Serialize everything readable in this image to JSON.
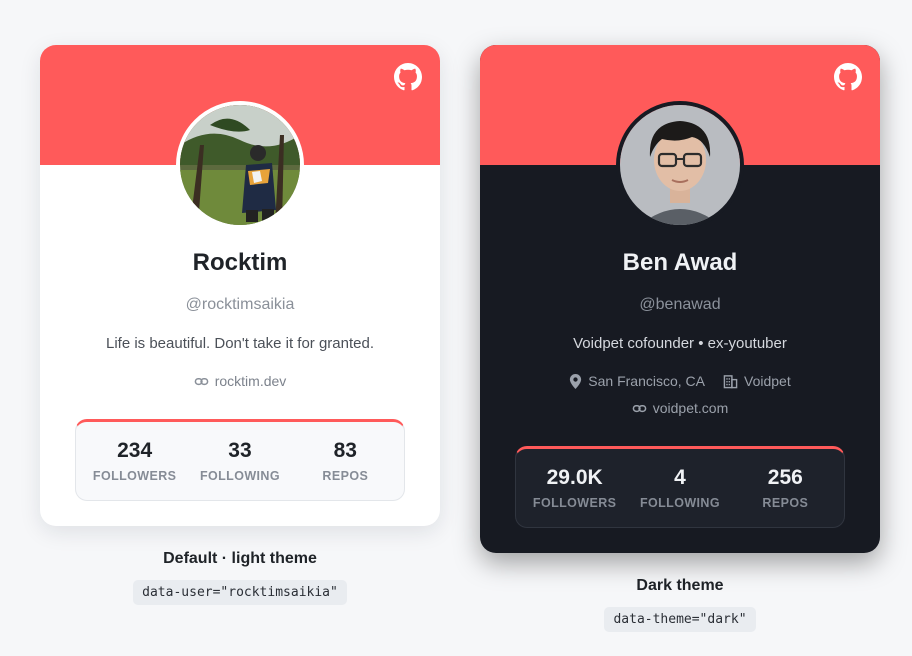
{
  "theme_colors": {
    "accent": "#ff5a5a",
    "light_card_bg": "#ffffff",
    "dark_card_bg": "#171a22"
  },
  "cards": [
    {
      "theme": "light",
      "icon": "github-icon",
      "name": "Rocktim",
      "handle": "@rocktimsaikia",
      "bio": "Life is beautiful. Don't take it for granted.",
      "website": "rocktim.dev",
      "stats": [
        {
          "value": "234",
          "label": "FOLLOWERS"
        },
        {
          "value": "33",
          "label": "FOLLOWING"
        },
        {
          "value": "83",
          "label": "REPOS"
        }
      ],
      "caption": "Default · light theme",
      "code": "data-user=\"rocktimsaikia\""
    },
    {
      "theme": "dark",
      "icon": "github-icon",
      "name": "Ben Awad",
      "handle": "@benawad",
      "bio": "Voidpet cofounder • ex-youtuber",
      "location": "San Francisco, CA",
      "company": "Voidpet",
      "website": "voidpet.com",
      "stats": [
        {
          "value": "29.0K",
          "label": "FOLLOWERS"
        },
        {
          "value": "4",
          "label": "FOLLOWING"
        },
        {
          "value": "256",
          "label": "REPOS"
        }
      ],
      "caption": "Dark theme",
      "code": "data-theme=\"dark\""
    }
  ]
}
